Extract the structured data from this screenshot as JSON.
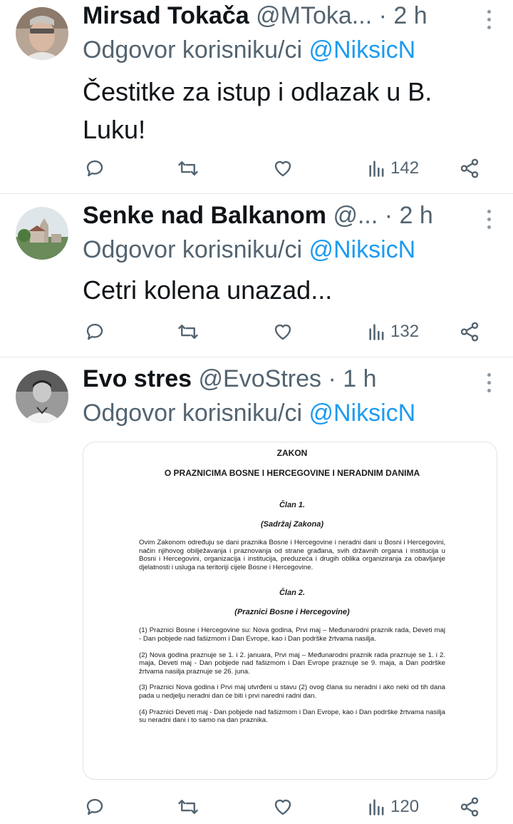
{
  "tweets": [
    {
      "name": "Mirsad Tokača",
      "handle": "@MToka...",
      "time": "· 2 h",
      "reply_prefix": "Odgovor korisniku/ci",
      "reply_mention": "@NiksicN",
      "text": "Čestitke za istup i odlazak u B. Luku!",
      "views": "142"
    },
    {
      "name": "Senke nad Balkanom",
      "handle": "@...",
      "time": "· 2 h",
      "reply_prefix": "Odgovor korisniku/ci",
      "reply_mention": "@NiksicN",
      "text": "Cetri kolena unazad...",
      "views": "132"
    },
    {
      "name": "Evo stres",
      "handle": "@EvoStres",
      "time": "· 1 h",
      "reply_prefix": "Odgovor korisniku/ci",
      "reply_mention": "@NiksicN",
      "views": "120",
      "document": {
        "heading": "ZAKON",
        "subheading": "O PRAZNICIMA BOSNE I HERCEGOVINE I NERADNIM DANIMA",
        "article1_title": "Član 1.",
        "article1_sub": "(Sadržaj Zakona)",
        "article1_text": "Ovim Zakonom određuju se dani praznika Bosne i Hercegovine i neradni dani u Bosni i Hercegovini, način njihovog obilježavanja i praznovanja od strane građana, svih državnih organa i institucija u Bosni i Hercegovini, organizacija i institucija, preduzeća i drugih oblika organiziranja za obavljanje djelatnosti i usluga na teritoriji cijele Bosne i Hercegovine.",
        "article2_title": "Član 2.",
        "article2_sub": "(Praznici Bosne i Hercegovine)",
        "p1": "(1) Praznici Bosne i Hercegovine su: Nova godina, Prvi maj – Međunarodni praznik rada, Deveti maj - Dan pobjede nad fašizmom i Dan Evrope, kao i Dan podrške žrtvama nasilja.",
        "p2": "(2) Nova godina praznuje se 1. i 2. januara, Prvi maj – Međunarodni praznik rada praznuje se 1. i 2. maja, Deveti maj - Dan pobjede nad fašizmom i Dan Evrope praznuje se 9. maja, a Dan podrške žrtvama nasilja praznuje se 26. juna.",
        "p3": "(3) Praznici Nova godina i Prvi maj utvrđeni u stavu (2) ovog člana su neradni i ako neki od tih dana pada u nedjelju neradni dan će biti i prvi naredni radni dan.",
        "p4": "(4) Praznici Deveti maj - Dan pobjede nad fašizmom i Dan Evrope, kao i Dan podrške žrtvama nasilja su neradni dani i to samo na dan praznika."
      }
    }
  ],
  "colors": {
    "link": "#1d9bf0",
    "muted": "#536471",
    "text": "#0f1419"
  },
  "icons": [
    "reply-icon",
    "retweet-icon",
    "like-icon",
    "views-icon",
    "share-icon",
    "more-icon"
  ]
}
